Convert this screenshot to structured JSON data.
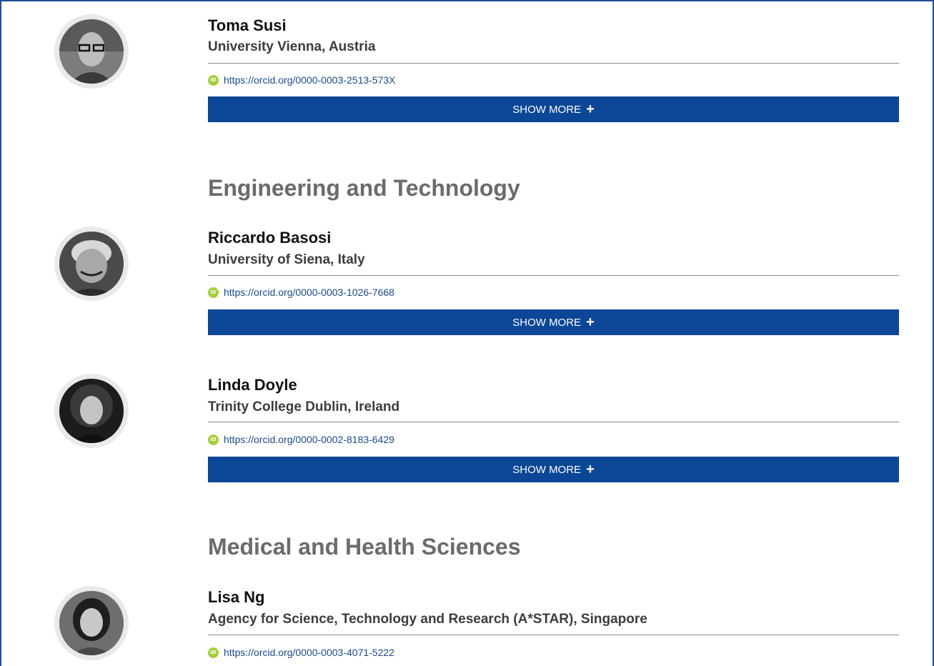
{
  "sections": [
    {
      "heading": "Engineering and Technology"
    },
    {
      "heading": "Medical and Health Sciences"
    }
  ],
  "people": [
    {
      "name": "Toma Susi",
      "affiliation": "University Vienna, Austria",
      "orcid_url": "https://orcid.org/0000-0003-2513-573X",
      "show_more_label": "SHOW MORE"
    },
    {
      "name": "Riccardo Basosi",
      "affiliation": "University of Siena, Italy",
      "orcid_url": "https://orcid.org/0000-0003-1026-7668",
      "show_more_label": "SHOW MORE"
    },
    {
      "name": "Linda Doyle",
      "affiliation": "Trinity College Dublin, Ireland",
      "orcid_url": "https://orcid.org/0000-0002-8183-6429",
      "show_more_label": "SHOW MORE"
    },
    {
      "name": "Lisa Ng",
      "affiliation": "Agency for Science, Technology and Research (A*STAR), Singapore",
      "orcid_url": "https://orcid.org/0000-0003-4071-5222"
    }
  ],
  "icons": {
    "orcid_icon": "orcid-icon",
    "orcid_glyph": "iD",
    "plus_icon": "plus-icon",
    "plus_glyph": "+"
  },
  "colors": {
    "accent": "#0b4796",
    "orcid_green": "#a6ce39",
    "heading_gray": "#6b6b6b",
    "frame_blue": "#1f4e96"
  }
}
